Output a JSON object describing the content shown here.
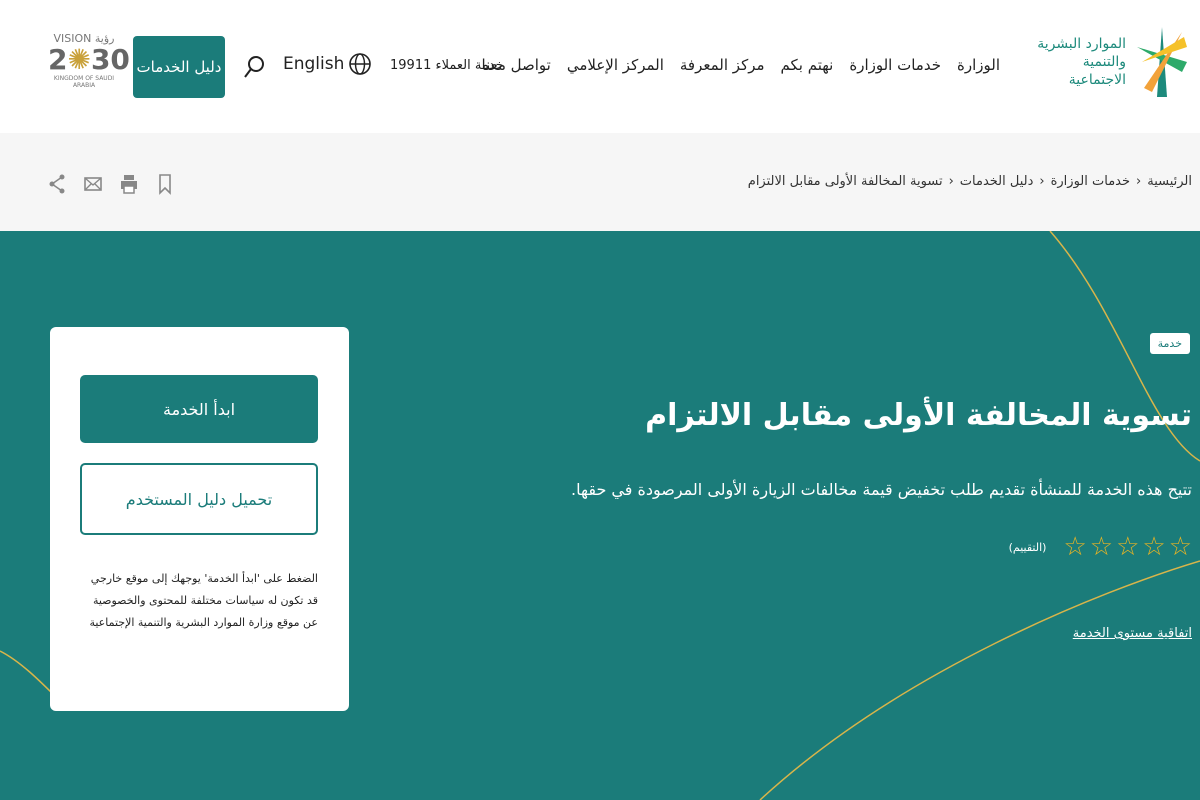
{
  "header": {
    "logo_text": "الموارد البشرية والتنمية الاجتماعية",
    "nav": [
      "الوزارة",
      "خدمات الوزارة",
      "نهتم بكم",
      "مركز المعرفة",
      "المركز الإعلامي",
      "تواصل معنا"
    ],
    "hotline": "خدمة العملاء 19911",
    "language": "English",
    "services_guide": "دليل الخدمات",
    "vision_logo": "VISION 2030 رؤية المملكة العربية السعودية KINGDOM OF SAUDI ARABIA"
  },
  "breadcrumb": [
    "الرئيسية",
    "خدمات الوزارة",
    "دليل الخدمات",
    "تسوية المخالفة الأولى مقابل الالتزام"
  ],
  "hero": {
    "badge": "خدمة",
    "title": "تسوية المخالفة الأولى مقابل الالتزام",
    "description": "تتيح هذه الخدمة للمنشأة تقديم طلب تخفيض قيمة مخالفات الزيارة الأولى المرصودة في حقها.",
    "rating": 0,
    "rating_max": 5,
    "rating_label": "(التقييم)",
    "sla_link": "اتفاقية مستوى الخدمة"
  },
  "card": {
    "start_button": "ابدأ الخدمة",
    "guide_button": "تحميل دليل المستخدم",
    "note": "الضغط على 'ابدأ الخدمة' يوجهك إلى موقع خارجي قد تكون له سياسات مختلفة للمحتوى والخصوصية عن موقع وزارة الموارد البشرية والتنمية الإجتماعية"
  },
  "colors": {
    "brand": "#1b7c7a",
    "star": "#e6b325"
  }
}
